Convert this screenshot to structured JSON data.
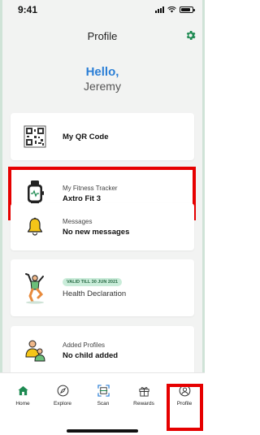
{
  "status_bar": {
    "time": "9:41"
  },
  "header": {
    "title": "Profile",
    "settings_icon": "gear-icon"
  },
  "greeting": {
    "hello": "Hello,",
    "name": "Jeremy"
  },
  "cards": {
    "qr": {
      "main": "My QR Code",
      "icon": "qr-code-icon"
    },
    "fitness": {
      "sub": "My Fitness Tracker",
      "main": "Axtro Fit 3",
      "icon": "smartwatch-icon"
    },
    "messages": {
      "sub": "Messages",
      "main": "No new messages",
      "icon": "bell-icon"
    },
    "health": {
      "badge": "VALID TILL 30 JUN 2021",
      "main": "Health Declaration",
      "icon": "exercise-person-icon"
    },
    "profiles": {
      "sub": "Added Profiles",
      "main": "No child added",
      "icon": "family-icon"
    }
  },
  "nav": {
    "home": "Home",
    "explore": "Explore",
    "scan": "Scan",
    "rewards": "Rewards",
    "profile": "Profile"
  },
  "colors": {
    "accent_blue": "#2b7fd6",
    "brand_green": "#1e8a52",
    "highlight_red": "#e60000",
    "badge_bg": "#c9ecd9"
  }
}
